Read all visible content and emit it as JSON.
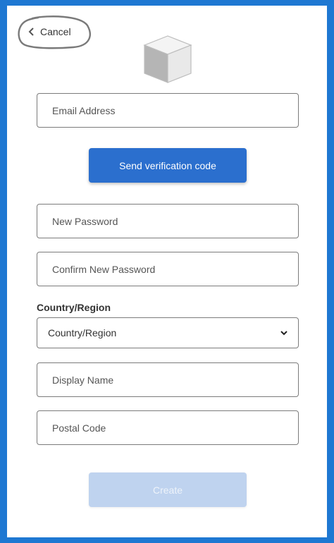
{
  "cancel_label": "Cancel",
  "email": {
    "placeholder": "Email Address"
  },
  "send_code_label": "Send verification code",
  "new_password": {
    "placeholder": "New Password"
  },
  "confirm_password": {
    "placeholder": "Confirm New Password"
  },
  "country": {
    "label": "Country/Region",
    "selected": "Country/Region"
  },
  "display_name": {
    "placeholder": "Display Name"
  },
  "postal_code": {
    "placeholder": "Postal Code"
  },
  "create_label": "Create",
  "colors": {
    "background": "#1e78d2",
    "primary_button": "#2b6fce",
    "disabled_button": "#bfd3ef"
  },
  "icons": {
    "logo": "cube-icon",
    "back": "chevron-left-icon",
    "dropdown": "chevron-down-icon"
  }
}
